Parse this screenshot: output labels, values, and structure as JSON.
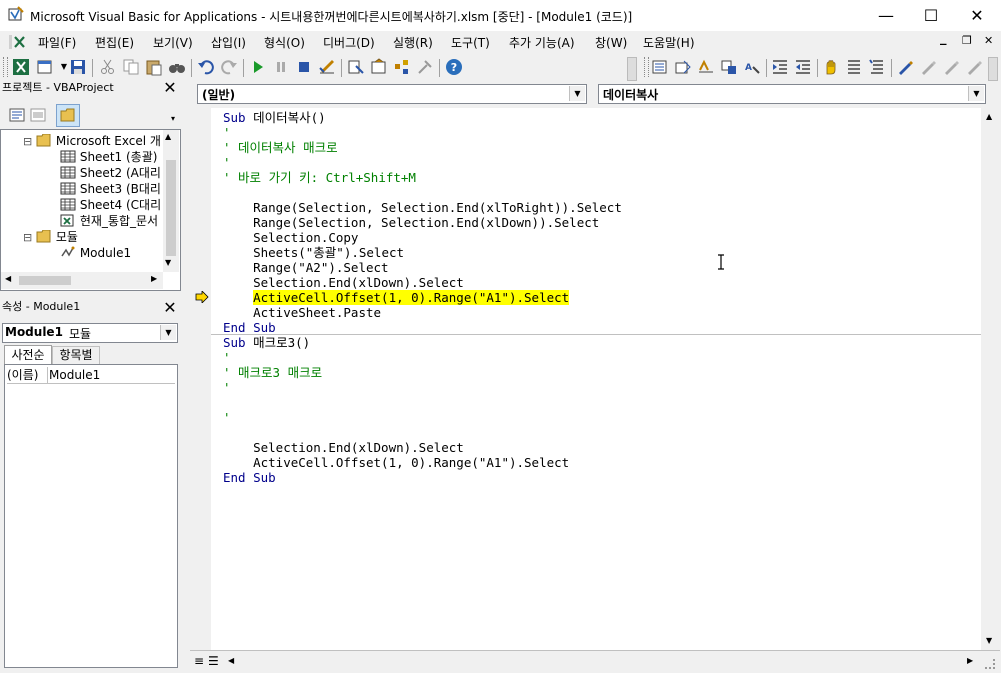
{
  "window": {
    "title": "Microsoft Visual Basic for Applications - 시트내용한꺼번에다른시트에복사하기.xlsm [중단] - [Module1 (코드)]",
    "minimize": "—",
    "maximize": "☐",
    "close": "✕"
  },
  "menu": {
    "items": [
      "파일(F)",
      "편집(E)",
      "보기(V)",
      "삽입(I)",
      "형식(O)",
      "디버그(D)",
      "실행(R)",
      "도구(T)",
      "추가 기능(A)",
      "창(W)",
      "도움말(H)"
    ],
    "child_min": "_",
    "child_restore": "❐",
    "child_close": "✕"
  },
  "project": {
    "title": "프로젝트 - VBAProject",
    "items": [
      {
        "label": "Microsoft Excel 개",
        "level": 1,
        "expander": "⊟"
      },
      {
        "label": "Sheet1 (총괄)",
        "level": 2
      },
      {
        "label": "Sheet2 (A대리",
        "level": 2
      },
      {
        "label": "Sheet3 (B대리",
        "level": 2
      },
      {
        "label": "Sheet4 (C대리",
        "level": 2
      },
      {
        "label": "현재_통합_문서",
        "level": 2
      },
      {
        "label": "모듈",
        "level": 1,
        "expander": "⊟"
      },
      {
        "label": "Module1",
        "level": 2
      }
    ]
  },
  "properties": {
    "title": "속성 - Module1",
    "object_name": "Module1",
    "object_type": "모듈",
    "tabs": [
      "사전순",
      "항목별"
    ],
    "row_name": "(이름)",
    "row_value": "Module1"
  },
  "editor": {
    "object_combo": "(일반)",
    "proc_combo": "데이터복사",
    "lines": [
      {
        "text": "Sub 데이터복사()",
        "kind": "sub"
      },
      {
        "text": "'",
        "kind": "comment"
      },
      {
        "text": "' 데이터복사 매크로",
        "kind": "comment"
      },
      {
        "text": "'",
        "kind": "comment"
      },
      {
        "text": "' 바로 가기 키: Ctrl+Shift+M",
        "kind": "comment"
      },
      {
        "text": "",
        "kind": "code"
      },
      {
        "text": "    Range(Selection, Selection.End(xlToRight)).Select",
        "kind": "code"
      },
      {
        "text": "    Range(Selection, Selection.End(xlDown)).Select",
        "kind": "code"
      },
      {
        "text": "    Selection.Copy",
        "kind": "code"
      },
      {
        "text": "    Sheets(\"총괄\").Select",
        "kind": "code"
      },
      {
        "text": "    Range(\"A2\").Select",
        "kind": "code"
      },
      {
        "text": "    Selection.End(xlDown).Select",
        "kind": "code"
      },
      {
        "text": "    ActiveCell.Offset(1, 0).Range(\"A1\").Select",
        "kind": "highlight"
      },
      {
        "text": "    ActiveSheet.Paste",
        "kind": "code"
      },
      {
        "text": "End Sub",
        "kind": "end"
      },
      {
        "text": "Sub 매크로3()",
        "kind": "sub"
      },
      {
        "text": "'",
        "kind": "comment"
      },
      {
        "text": "' 매크로3 매크로",
        "kind": "comment"
      },
      {
        "text": "'",
        "kind": "comment"
      },
      {
        "text": "",
        "kind": "code"
      },
      {
        "text": "'",
        "kind": "comment"
      },
      {
        "text": "",
        "kind": "code"
      },
      {
        "text": "    Selection.End(xlDown).Select",
        "kind": "code"
      },
      {
        "text": "    ActiveCell.Offset(1, 0).Range(\"A1\").Select",
        "kind": "code"
      },
      {
        "text": "End Sub",
        "kind": "end"
      }
    ]
  },
  "colors": {
    "keyword": "#00008b",
    "comment": "#008000",
    "highlight": "#ffff00",
    "arrow": "#ffd700"
  }
}
